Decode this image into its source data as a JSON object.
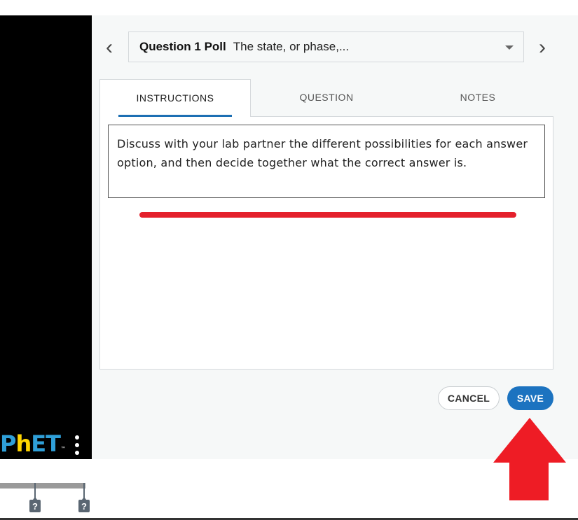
{
  "sim": {
    "logo_text_p": "P",
    "logo_text_h": "h",
    "logo_text_et": "ET",
    "logo_tm": "™",
    "help_marks": [
      "?",
      "?"
    ]
  },
  "header": {
    "prev_arrow": "‹",
    "next_arrow": "›",
    "question_label": "Question 1 Poll",
    "question_text": "The state, or phase,..."
  },
  "tabs": [
    {
      "label": "INSTRUCTIONS",
      "active": true
    },
    {
      "label": "QUESTION",
      "active": false
    },
    {
      "label": "NOTES",
      "active": false
    }
  ],
  "instructions": {
    "text": "Discuss with your lab partner the different possibilities for each answer option, and then decide together what the correct answer is."
  },
  "buttons": {
    "cancel": "CANCEL",
    "save": "SAVE"
  },
  "colors": {
    "accent": "#1c73c0",
    "annotation_red": "#ee1c25",
    "phet_blue": "#2f9fd8",
    "phet_yellow": "#ffd400"
  },
  "icons": {
    "prev": "chevron-left-icon",
    "next": "chevron-right-icon",
    "dropdown": "caret-down-icon",
    "menu": "kebab-menu-icon",
    "help": "help-tag-icon",
    "annotation": "red-up-arrow-icon"
  }
}
